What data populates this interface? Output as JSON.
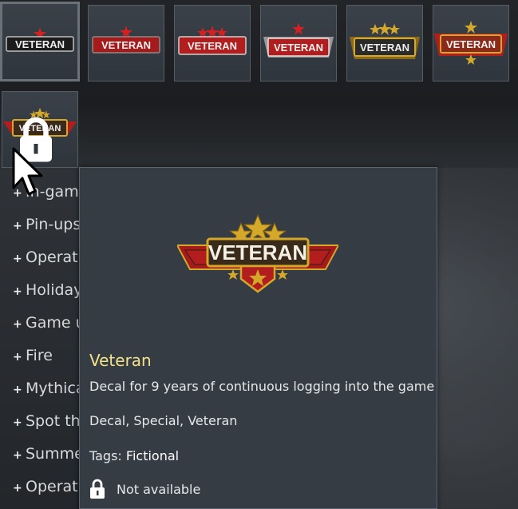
{
  "decal_grid": {
    "items": [
      {
        "label": "VETERAN",
        "style": "black",
        "selected": true,
        "locked": false
      },
      {
        "label": "VETERAN",
        "style": "red",
        "selected": false,
        "locked": false
      },
      {
        "label": "VETERAN",
        "style": "red-stripe",
        "selected": false,
        "locked": false
      },
      {
        "label": "VETERAN",
        "style": "silver",
        "selected": false,
        "locked": false
      },
      {
        "label": "VETERAN",
        "style": "gold",
        "selected": false,
        "locked": false
      },
      {
        "label": "VETERAN",
        "style": "gold-red",
        "selected": false,
        "locked": false
      },
      {
        "label": "VETERAN",
        "style": "gold-emblem",
        "selected": false,
        "locked": true
      }
    ]
  },
  "categories": [
    {
      "label": "In-gam"
    },
    {
      "label": "Pin-ups"
    },
    {
      "label": "Operati"
    },
    {
      "label": "Holiday"
    },
    {
      "label": "Game u"
    },
    {
      "label": "Fire"
    },
    {
      "label": "Mythica"
    },
    {
      "label": "Spot th"
    },
    {
      "label": "Summe"
    },
    {
      "label": "Operati"
    }
  ],
  "tooltip": {
    "image_label": "VETERAN",
    "title": "Veteran",
    "description": "Decal for 9 years of continuous logging into the game",
    "categories_line": "Decal, Special, Veteran",
    "tags_label": "Tags:",
    "tags_value": "Fictional",
    "availability": "Not available"
  },
  "colors": {
    "title_accent": "#f4e28a",
    "tooltip_bg": "#363c44",
    "badge_gold": "#d4a82a",
    "badge_red": "#b21e1e"
  },
  "icons": {
    "lock": "lock-icon",
    "cursor": "mouse-cursor-icon",
    "plus": "plus-icon"
  }
}
